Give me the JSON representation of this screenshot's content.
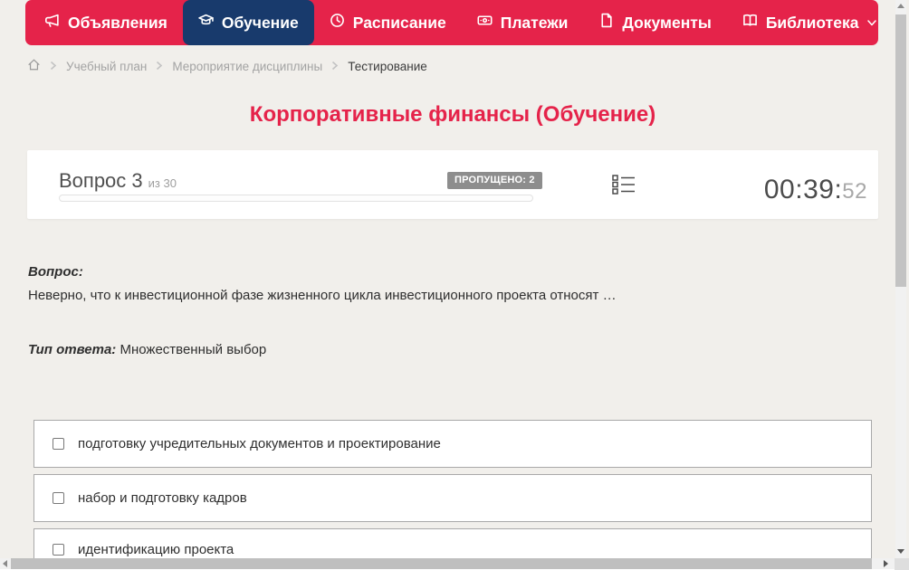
{
  "colors": {
    "accent_red": "#e5234a",
    "active_navy": "#183a6c",
    "page_bg": "#f1efeb",
    "badge_gray": "#8d8d8d"
  },
  "nav": {
    "items": [
      {
        "label": "Объявления",
        "icon": "megaphone-icon",
        "active": false
      },
      {
        "label": "Обучение",
        "icon": "graduation-cap-icon",
        "active": true
      },
      {
        "label": "Расписание",
        "icon": "clock-icon",
        "active": false
      },
      {
        "label": "Платежи",
        "icon": "banknote-icon",
        "active": false
      },
      {
        "label": "Документы",
        "icon": "document-icon",
        "active": false
      },
      {
        "label": "Библиотека",
        "icon": "book-icon",
        "active": false,
        "has_dropdown": true
      }
    ]
  },
  "breadcrumb": {
    "items": [
      {
        "label": "Учебный план",
        "current": false
      },
      {
        "label": "Мероприятие дисциплины",
        "current": false
      },
      {
        "label": "Тестирование",
        "current": true
      }
    ]
  },
  "page_title": "Корпоративные финансы (Обучение)",
  "quiz": {
    "question_label": "Вопрос 3",
    "question_of": "из 30",
    "skipped_badge": "ПРОПУЩЕНО: 2",
    "timer_main": "00:39:",
    "timer_seconds": "52",
    "progress_percent": 0,
    "question_heading": "Вопрос:",
    "question_text": "Неверно, что к инвестиционной фазе жизненного цикла инвестиционного проекта относят …",
    "answer_type_label": "Тип ответа:",
    "answer_type_value": "Множественный выбор",
    "options": [
      {
        "label": "подготовку учредительных документов и проектирование",
        "checked": false
      },
      {
        "label": "набор и подготовку кадров",
        "checked": false
      },
      {
        "label": "идентификацию проекта",
        "checked": false
      }
    ]
  }
}
